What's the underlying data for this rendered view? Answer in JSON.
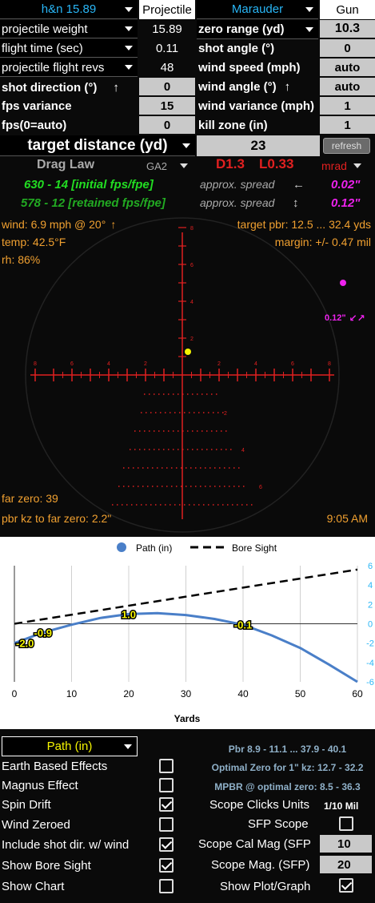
{
  "header": {
    "caliber": "h&n 15.89",
    "projectile_tab": "Projectile",
    "gun_select": "Marauder",
    "gun_tab": "Gun"
  },
  "inputs_left": [
    {
      "label": "projectile weight",
      "value": "15.89"
    },
    {
      "label": "flight time (sec)",
      "value": "0.11"
    },
    {
      "label": "projectile flight revs",
      "value": "48"
    }
  ],
  "inputs_left_boxed": [
    {
      "label": "shot direction (°)",
      "arrow": "↑",
      "value": "0"
    },
    {
      "label": "fps variance",
      "value": "15"
    },
    {
      "label": "fps(0=auto)",
      "value": "0"
    }
  ],
  "inputs_right": [
    {
      "label": "zero range (yd)",
      "value": "10.3"
    },
    {
      "label": "shot angle (°)",
      "value": "0"
    },
    {
      "label": "wind speed (mph)",
      "value": "auto"
    },
    {
      "label": "wind angle (°)",
      "arrow": "↑",
      "value": "auto"
    },
    {
      "label": "wind variance (mph)",
      "value": "1"
    },
    {
      "label": "kill zone (in)",
      "value": "1"
    }
  ],
  "target": {
    "label": "target distance (yd)",
    "value": "23",
    "refresh": "refresh"
  },
  "drag": {
    "label": "Drag Law",
    "model": "GA2",
    "d_value": "D1.3",
    "l_value": "L0.33",
    "unit": "mrad"
  },
  "energy": {
    "initial": "630 - 14 [initial fps/fpe]",
    "retained": "578 - 12 [retained fps/fpe]",
    "spread1_label": "approx. spread",
    "spread1_arrow": "←",
    "spread1_value": "0.02\"",
    "spread2_label": "approx. spread",
    "spread2_arrow": "↕",
    "spread2_value": "0.12\""
  },
  "scope": {
    "wind": "wind: 6.9 mph @ 20°",
    "wind_arrow": "↑",
    "temp": "temp: 42.5°F",
    "rh": "rh: 86%",
    "pbr": "target pbr: 12.5 ... 32.4 yds",
    "margin": "margin: +/- 0.47 mil",
    "spread_note": "0.12\"",
    "spread_arrow": "↙↗",
    "far_zero": "far zero: 39",
    "pbr_kz": "pbr kz to far zero: 2.2\"",
    "time": "9:05 AM",
    "horiz_ticks": [
      "8",
      "6",
      "4",
      "2",
      "2",
      "4",
      "6",
      "8"
    ],
    "up_ticks": [
      "8",
      "6",
      "4",
      "2"
    ],
    "down_ticks": [
      "2",
      "4",
      "6"
    ]
  },
  "colors": {
    "blue": "#29b6f6",
    "reticle": "#e02020",
    "green": "#22dd22",
    "magenta": "#ee22ee",
    "orange": "#f0a030",
    "yellow": "#f5f500",
    "path": "#4a7fc8"
  },
  "chart_data": {
    "type": "line",
    "legend": [
      "Path (in)",
      "Bore Sight"
    ],
    "xlabel": "Yards",
    "x_ticks": [
      "0",
      "10",
      "20",
      "30",
      "40",
      "50",
      "60"
    ],
    "y_ticks": [
      "6",
      "4",
      "2",
      "0",
      "-2",
      "-4",
      "-6"
    ],
    "xlim": [
      0,
      60
    ],
    "ylim": [
      -6,
      6
    ],
    "series": [
      {
        "name": "Path (in)",
        "x": [
          0,
          5,
          10,
          15,
          20,
          25,
          30,
          35,
          40,
          45,
          50,
          55,
          60
        ],
        "y": [
          -2.0,
          -0.9,
          -0.1,
          0.6,
          1.0,
          1.1,
          0.9,
          0.5,
          -0.1,
          -1.2,
          -2.5,
          -4.2,
          -6.0
        ]
      },
      {
        "name": "Bore Sight",
        "x": [
          0,
          60
        ],
        "y": [
          0,
          5.6
        ]
      }
    ],
    "annotations": [
      {
        "x": 0,
        "y": -2.0,
        "text": "-2.0"
      },
      {
        "x": 5,
        "y": -0.9,
        "text": "-0.9"
      },
      {
        "x": 20,
        "y": 1.0,
        "text": "1.0"
      },
      {
        "x": 40,
        "y": -0.1,
        "text": "-0.1"
      }
    ]
  },
  "bottom": {
    "dropdown": "Path (in)",
    "left_checks": [
      {
        "label": "Earth Based Effects",
        "checked": false
      },
      {
        "label": "Magnus Effect",
        "checked": false
      },
      {
        "label": "Spin Drift",
        "checked": true
      },
      {
        "label": "Wind Zeroed",
        "checked": false
      },
      {
        "label": "Include shot dir. w/ wind",
        "checked": true
      },
      {
        "label": "Show Bore Sight",
        "checked": true
      },
      {
        "label": "Show Chart",
        "checked": false
      }
    ],
    "pbr_info": "Pbr 8.9 - 11.1 ... 37.9 - 40.1",
    "optimal_zero": "Optimal Zero for 1\" kz: 12.7 - 32.2",
    "mpbr": "MPBR @ optimal zero: 8.5 - 36.3",
    "scope_clicks_label": "Scope Clicks Units",
    "scope_clicks_value": "1/10 Mil",
    "sfp_label": "SFP Scope",
    "sfp_checked": false,
    "cal_mag_label": "Scope Cal Mag (SFP",
    "cal_mag_value": "10",
    "mag_label": "Scope Mag. (SFP)",
    "mag_value": "20",
    "plot_label": "Show Plot/Graph",
    "plot_checked": true
  }
}
